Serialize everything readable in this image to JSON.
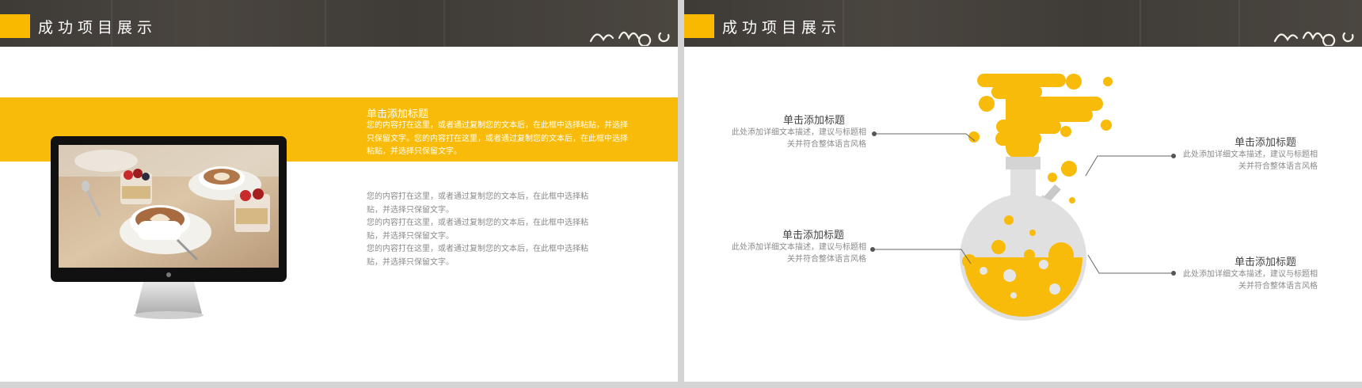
{
  "slides": [
    {
      "header": {
        "title": "成功项目展示"
      },
      "band": {
        "title": "单击添加标题",
        "body": "您的内容打在这里，或者通过复制您的文本后，在此框中选择粘贴，并选择只保留文字。您的内容打在这里，或者通过复制您的文本后，在此框中选择粘贴，并选择只保留文字。"
      },
      "body_paragraphs": [
        "您的内容打在这里，或者通过复制您的文本后，在此框中选择粘贴，并选择只保留文字。",
        "您的内容打在这里，或者通过复制您的文本后，在此框中选择粘贴，并选择只保留文字。",
        "您的内容打在这里，或者通过复制您的文本后，在此框中选择粘贴，并选择只保留文字。"
      ]
    },
    {
      "header": {
        "title": "成功项目展示"
      },
      "labels": [
        {
          "title": "单击添加标题",
          "desc": "此处添加详细文本描述，建议与标题相关并符合整体语言风格"
        },
        {
          "title": "单击添加标题",
          "desc": "此处添加详细文本描述，建议与标题相关并符合整体语言风格"
        },
        {
          "title": "单击添加标题",
          "desc": "此处添加详细文本描述，建议与标题相关并符合整体语言风格"
        },
        {
          "title": "单击添加标题",
          "desc": "此处添加详细文本描述，建议与标题相关并符合整体语言风格"
        }
      ]
    }
  ],
  "colors": {
    "accent": "#f8b900",
    "header_bg": "#433e39",
    "flask_gray": "#dddddd",
    "text_gray": "#8a8a8a"
  },
  "icons": [
    "chalk-doodle-icon",
    "apple-logo-icon"
  ]
}
